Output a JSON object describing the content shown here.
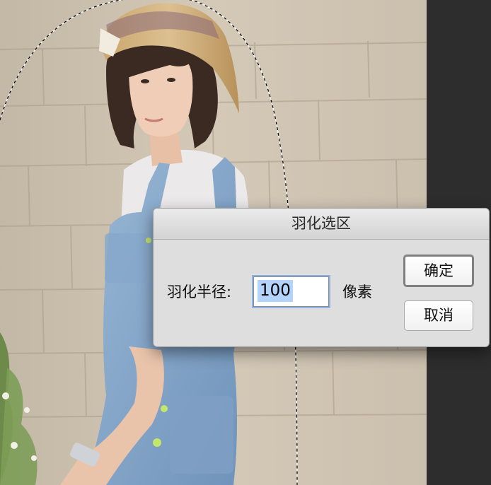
{
  "dialog": {
    "title": "羽化选区",
    "radius_label": "羽化半径:",
    "radius_value": "100",
    "unit_label": "像素",
    "ok_label": "确定",
    "cancel_label": "取消"
  },
  "colors": {
    "canvas_bg": "#cfc4b2",
    "panel_bg": "#2d2d2d",
    "dialog_bg": "#dedede",
    "selection_highlight": "#b3d3fb",
    "focus_ring": "#8fb4e4"
  }
}
